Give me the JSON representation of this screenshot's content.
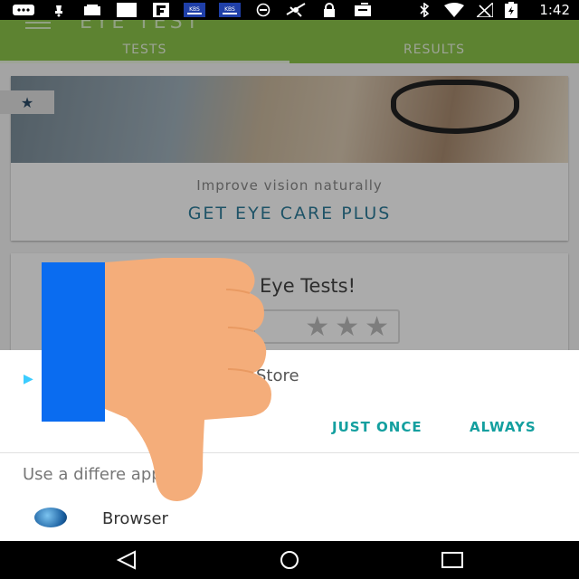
{
  "status_bar": {
    "time": "1:42",
    "icons": [
      "message-icon",
      "mute-icon",
      "cast-icon",
      "tv-icon",
      "flipboard-icon",
      "kbs-news-icon",
      "kbs-news-icon",
      "sync-icon",
      "no-signal-icon",
      "lock-icon",
      "inbox-icon",
      "bluetooth-icon",
      "wifi-icon",
      "signal-icon",
      "battery-icon"
    ],
    "kbs_label": "KBS"
  },
  "app": {
    "title": "EYE  TEST",
    "tabs": [
      {
        "label": "TESTS",
        "active": true
      },
      {
        "label": "RESULTS",
        "active": false
      }
    ],
    "promo": {
      "tagline": "Improve vision naturally",
      "cta": "GET EYE CARE PLUS"
    },
    "rate_card": {
      "text": "Eye Tests!"
    }
  },
  "chooser": {
    "store_label": "Store",
    "just_once": "JUST ONCE",
    "always": "ALWAYS",
    "use_different": "Use a differe    app",
    "browser_label": "Browser"
  },
  "overlay": {
    "icon": "thumbs-down-icon",
    "colors": {
      "blue": "#0a6cf0",
      "skin": "#f4ad7a"
    }
  },
  "colors": {
    "app_bar": "#8bc34a",
    "accent_button": "#139f9f",
    "cta": "#2e7d9a"
  }
}
